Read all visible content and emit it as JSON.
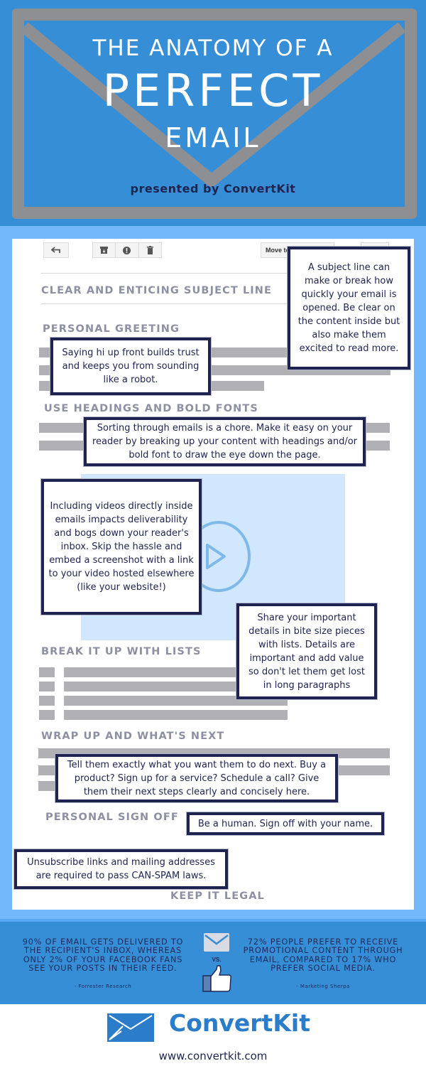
{
  "header": {
    "title_line1": "THE ANATOMY OF A",
    "title_line2": "PERFECT",
    "title_line3": "EMAIL",
    "presented_by": "presented by ConvertKit",
    "colors": {
      "background": "#368fd6",
      "envelope": "#8e8f93",
      "title": "#ffffff",
      "presented": "#1e2350"
    }
  },
  "toolbar": {
    "reply_icon": "reply-arrow-icon",
    "archive_icon": "archive-icon",
    "spam_icon": "spam-exclamation-icon",
    "delete_icon": "trash-icon",
    "move_to_label": "Move to"
  },
  "sections": {
    "subject": "CLEAR AND ENTICING SUBJECT LINE",
    "greeting": "PERSONAL GREETING",
    "headings": "USE HEADINGS AND BOLD FONTS",
    "lists": "BREAK IT UP WITH LISTS",
    "wrap_up": "WRAP UP AND WHAT'S NEXT",
    "sign_off": "PERSONAL SIGN OFF",
    "legal": "KEEP IT LEGAL"
  },
  "callouts": {
    "subject": "A subject line can make or break how quickly your email is opened. Be clear on the content inside but also make them excited to read more.",
    "greeting": "Saying hi up front builds trust and keeps you from sounding like a robot.",
    "headings": "Sorting through emails is a chore. Make it easy on your reader by breaking up your content with headings and/or bold font to draw the eye down the page.",
    "video": "Including videos directly inside emails impacts deliverability and bogs down your reader's inbox. Skip the hassle and embed a screenshot with a link to your video hosted elsewhere (like your website!)",
    "lists": "Share your important details in bite size pieces with lists. Details are important and add value so don't let them get lost in long paragraphs",
    "wrap_up": "Tell them exactly what you want them to do next. Buy a product? Sign up for a service? Schedule a call? Give them their next steps clearly and concisely here.",
    "sign_off": "Be a human. Sign off with your name.",
    "legal": "Unsubscribe links and mailing addresses are required to pass CAN-SPAM laws."
  },
  "video": {
    "icon": "play-icon",
    "color": "#d1e7fd"
  },
  "stats": {
    "left": {
      "text": "90% of email gets delivered to the recipient's inbox, whereas only 2% of your Facebook fans see your posts in their feed.",
      "source": "- Forrester Research"
    },
    "vs_label": "VS.",
    "right": {
      "text": "72% people prefer to receive promotional content through email, compared to 17% who prefer social media.",
      "source": "- Marketing Sherpa"
    }
  },
  "footer": {
    "brand": "ConvertKit",
    "url": "www.convertkit.com",
    "brand_color": "#2b7cc9"
  }
}
